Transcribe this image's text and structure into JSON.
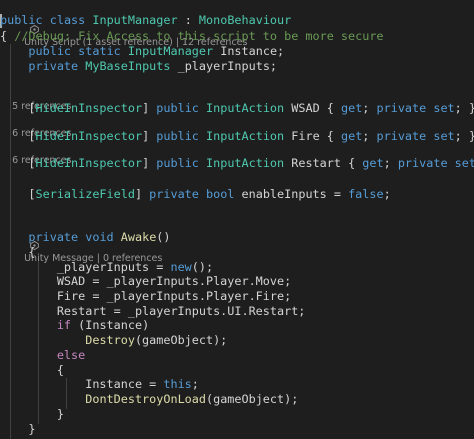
{
  "colors": {
    "background": "#1e1e1e",
    "keyword": "#569cd6",
    "control": "#c586c0",
    "type": "#4ec9b0",
    "function": "#dcdcaa",
    "comment": "#6a9955",
    "identifier": "#d4d4d4",
    "codelens": "#999999"
  },
  "codelens": [
    {
      "icon": "unity-icon",
      "parts": [
        "Unity Script (1 asset reference)",
        " | ",
        "12 references"
      ]
    },
    {
      "icon": "",
      "parts": [
        "5 references"
      ]
    },
    {
      "icon": "",
      "parts": [
        "6 references"
      ]
    },
    {
      "icon": "",
      "parts": [
        "6 references"
      ]
    },
    {
      "icon": "unity-icon",
      "parts": [
        "Unity Message",
        " | ",
        "0 references"
      ]
    }
  ],
  "lines": [
    [
      [
        "kw",
        "public"
      ],
      [
        "op",
        " "
      ],
      [
        "kw",
        "class"
      ],
      [
        "op",
        " "
      ],
      [
        "type",
        "InputManager"
      ],
      [
        "op",
        " : "
      ],
      [
        "type",
        "MonoBehaviour"
      ]
    ],
    [
      [
        "op",
        "{ "
      ],
      [
        "cmt",
        "//Debug: Fix Access to this script to be more secure"
      ]
    ],
    [
      [
        "op",
        "    "
      ],
      [
        "kw",
        "public"
      ],
      [
        "op",
        " "
      ],
      [
        "kw",
        "static"
      ],
      [
        "op",
        " "
      ],
      [
        "type",
        "InputManager"
      ],
      [
        "op",
        " Instance;"
      ]
    ],
    [
      [
        "op",
        "    "
      ],
      [
        "kw",
        "private"
      ],
      [
        "op",
        " "
      ],
      [
        "type",
        "MyBaseInputs"
      ],
      [
        "op",
        " _playerInputs;"
      ]
    ],
    [
      [
        "op",
        ""
      ]
    ],
    [
      [
        "op",
        "    ["
      ],
      [
        "attr",
        "HideInInspector"
      ],
      [
        "op",
        "] "
      ],
      [
        "kw",
        "public"
      ],
      [
        "op",
        " "
      ],
      [
        "type",
        "InputAction"
      ],
      [
        "op",
        " WSAD { "
      ],
      [
        "kw",
        "get"
      ],
      [
        "op",
        "; "
      ],
      [
        "kw",
        "private"
      ],
      [
        "op",
        " "
      ],
      [
        "kw",
        "set"
      ],
      [
        "op",
        "; }"
      ]
    ],
    [
      [
        "op",
        "    ["
      ],
      [
        "attr",
        "HideInInspector"
      ],
      [
        "op",
        "] "
      ],
      [
        "kw",
        "public"
      ],
      [
        "op",
        " "
      ],
      [
        "type",
        "InputAction"
      ],
      [
        "op",
        " Fire { "
      ],
      [
        "kw",
        "get"
      ],
      [
        "op",
        "; "
      ],
      [
        "kw",
        "private"
      ],
      [
        "op",
        " "
      ],
      [
        "kw",
        "set"
      ],
      [
        "op",
        "; }"
      ]
    ],
    [
      [
        "op",
        "    ["
      ],
      [
        "attr",
        "HideInInspector"
      ],
      [
        "op",
        "] "
      ],
      [
        "kw",
        "public"
      ],
      [
        "op",
        " "
      ],
      [
        "type",
        "InputAction"
      ],
      [
        "op",
        " Restart { "
      ],
      [
        "kw",
        "get"
      ],
      [
        "op",
        "; "
      ],
      [
        "kw",
        "private"
      ],
      [
        "op",
        " "
      ],
      [
        "kw",
        "set"
      ],
      [
        "op",
        "; }"
      ]
    ],
    [
      [
        "op",
        ""
      ]
    ],
    [
      [
        "op",
        "    ["
      ],
      [
        "attr",
        "SerializeField"
      ],
      [
        "op",
        "] "
      ],
      [
        "kw",
        "private"
      ],
      [
        "op",
        " "
      ],
      [
        "kw",
        "bool"
      ],
      [
        "op",
        " enableInputs = "
      ],
      [
        "kw",
        "false"
      ],
      [
        "op",
        ";"
      ]
    ],
    [
      [
        "op",
        ""
      ]
    ],
    [
      [
        "op",
        "    "
      ],
      [
        "kw",
        "private"
      ],
      [
        "op",
        " "
      ],
      [
        "kw",
        "void"
      ],
      [
        "op",
        " "
      ],
      [
        "fn",
        "Awake"
      ],
      [
        "op",
        "()"
      ]
    ],
    [
      [
        "op",
        "    {"
      ]
    ],
    [
      [
        "op",
        "        _playerInputs = "
      ],
      [
        "kw",
        "new"
      ],
      [
        "op",
        "();"
      ]
    ],
    [
      [
        "op",
        "        WSAD = _playerInputs.Player.Move;"
      ]
    ],
    [
      [
        "op",
        "        Fire = _playerInputs.Player.Fire;"
      ]
    ],
    [
      [
        "op",
        "        Restart = _playerInputs.UI.Restart;"
      ]
    ],
    [
      [
        "op",
        "        "
      ],
      [
        "ctl",
        "if"
      ],
      [
        "op",
        " (Instance)"
      ]
    ],
    [
      [
        "op",
        "            "
      ],
      [
        "fn",
        "Destroy"
      ],
      [
        "op",
        "(gameObject);"
      ]
    ],
    [
      [
        "op",
        "        "
      ],
      [
        "ctl",
        "else"
      ]
    ],
    [
      [
        "op",
        "        {"
      ]
    ],
    [
      [
        "op",
        "            Instance = "
      ],
      [
        "kw",
        "this"
      ],
      [
        "op",
        ";"
      ]
    ],
    [
      [
        "op",
        "            "
      ],
      [
        "fn",
        "DontDestroyOnLoad"
      ],
      [
        "op",
        "(gameObject);"
      ]
    ],
    [
      [
        "op",
        "        }"
      ]
    ],
    [
      [
        "op",
        "    }"
      ]
    ]
  ]
}
